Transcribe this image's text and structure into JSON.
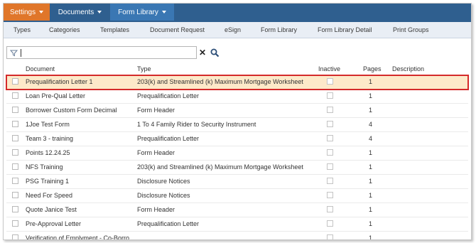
{
  "colors": {
    "settings_tab": "#e0762a",
    "documents_tab": "#2f5f8f",
    "library_tab": "#3a77b3",
    "selected_row_bg": "#fde9c9",
    "selected_row_border": "#d42a2a"
  },
  "top_tabs": [
    {
      "label": "Settings",
      "icon": "chevron-down-icon"
    },
    {
      "label": "Documents",
      "icon": "chevron-down-icon"
    },
    {
      "label": "Form Library",
      "icon": "chevron-down-icon"
    }
  ],
  "subnav": [
    "Types",
    "Categories",
    "Templates",
    "Document Request",
    "eSign",
    "Form Library",
    "Form Library Detail",
    "Print Groups"
  ],
  "search": {
    "value": "",
    "icons": [
      "filter-icon",
      "clear-icon",
      "search-icon"
    ]
  },
  "table": {
    "headers": {
      "document": "Document",
      "type": "Type",
      "inactive": "Inactive",
      "pages": "Pages",
      "description": "Description"
    },
    "rows": [
      {
        "document": "Prequalification Letter 1",
        "type": "203(k) and Streamlined (k) Maximum Mortgage Worksheet",
        "pages": "1",
        "selected": true
      },
      {
        "document": "Loan Pre-Qual Letter",
        "type": "Prequalification Letter",
        "pages": "1"
      },
      {
        "document": "Borrower Custom Form Decimal",
        "type": "Form Header",
        "pages": "1"
      },
      {
        "document": "1Joe Test Form",
        "type": "1 To 4 Family Rider to Security Instrument",
        "pages": "4"
      },
      {
        "document": "Team 3 - training",
        "type": "Prequalification Letter",
        "pages": "4"
      },
      {
        "document": "Points 12.24.25",
        "type": "Form Header",
        "pages": "1"
      },
      {
        "document": "NFS Training",
        "type": "203(k) and Streamlined (k) Maximum Mortgage Worksheet",
        "pages": "1"
      },
      {
        "document": "PSG Training 1",
        "type": "Disclosure Notices",
        "pages": "1"
      },
      {
        "document": "Need For Speed",
        "type": "Disclosure Notices",
        "pages": "1"
      },
      {
        "document": "Quote Janice Test",
        "type": "Form Header",
        "pages": "1"
      },
      {
        "document": "Pre-Approval Letter",
        "type": "Prequalification Letter",
        "pages": "1"
      },
      {
        "document": "Verification of Emplyment - Co-Borro...",
        "type": "",
        "pages": "1"
      }
    ]
  }
}
